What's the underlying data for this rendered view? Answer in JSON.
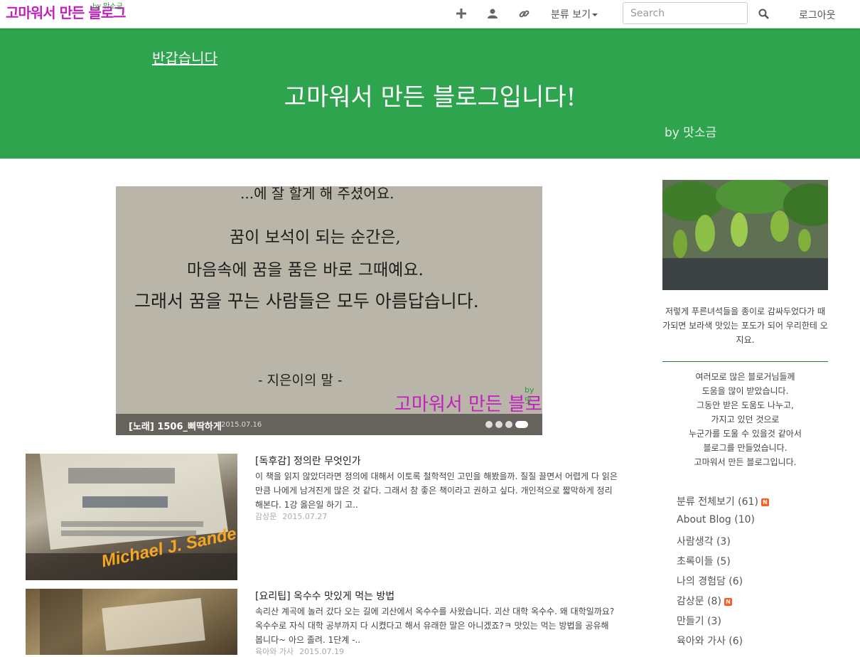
{
  "nav": {
    "logo": "고마워서 만든 블로그",
    "logo_by": "by 맛소금",
    "category_menu": "분류 보기",
    "search_placeholder": "Search",
    "logout": "로그아웃"
  },
  "banner": {
    "link": "반갑습니다",
    "title": "고마워서 만든 블로그입니다!",
    "by": "by 맛소금",
    "color": "#2ea44f"
  },
  "slider": {
    "image_lines": [
      "...에 잘 할게 해 주셨어요.",
      "꿈이 보석이 되는 순간은,",
      "마음속에 꿈을 품은 바로 그때예요.",
      "그래서 꿈을 꾸는 사람들은 모두 아름답습니다.",
      "- 지은이의 말 -"
    ],
    "watermark": "고마워서 만든 블로그",
    "watermark_by": "by 맛",
    "caption_title": "[노래] 1506_삐딱하게",
    "caption_date": "2015.07.16",
    "dot_count": 4,
    "active_dot": 4
  },
  "posts": [
    {
      "title": "[독후감] 정의란 무엇인가",
      "excerpt": "이 책을 읽지 않았더라면 정의에 대해서 이토록 철학적인 고민을 해봤을까. 질질 끌면서 어렵게 다 읽은 만큼 나에게 남겨진게 많은 것 같다. 그래서 참 좋은 책이라고 권하고 싶다. 개인적으로 짧막하게 정리해본다. 1강 옳은일 하기 고..",
      "category": "감상문",
      "date": "2015.07.27",
      "thumb_text": "Michael J. Sandel"
    },
    {
      "title": "[요리팁] 옥수수 맛있게 먹는 방법",
      "excerpt": "속리산 계곡에 놀러 갔다 오는 길에 괴산에서 옥수수를 사왔습니다. 괴산 대학 옥수수. 왜 대학일까요? 옥수수로 자식 대학 공부까지 다 시켰다고 해서 유래한 말은 아니겠죠?ㅋ 맛있는 먹는 방법을 공유해 봅니다~ 아으 졸려. 1단계 -..",
      "category": "육아와 가사",
      "date": "2015.07.19",
      "thumb_text": ""
    }
  ],
  "sidebar": {
    "caption": "저렇게 푸른녀석들을 종이로 감싸두었다가 때가되면 보라색 맛있는 포도가 되어 우리한테 오지요.",
    "about_lines": [
      "여러모로 많은 블로거님들께",
      "도움을 많이 받았습니다.",
      "그동안 받은 도움도 나누고,",
      "가지고 있던 것으로",
      "누군가를 도울 수 있을것 같아서",
      "블로그를 만들었습니다.",
      "고마워서 만든 블로그입니다."
    ],
    "categories": [
      {
        "label": "분류 전체보기 (61)",
        "new": true
      },
      {
        "label": "About Blog (10)",
        "new": false
      },
      {
        "label": "사람생각 (3)",
        "new": false
      },
      {
        "label": "초록이들 (5)",
        "new": false
      },
      {
        "label": "나의 경험담 (6)",
        "new": false
      },
      {
        "label": "감상문 (8)",
        "new": true
      },
      {
        "label": "만들기 (3)",
        "new": false
      },
      {
        "label": "육아와 가사 (6)",
        "new": false
      }
    ],
    "new_badge": "N"
  }
}
